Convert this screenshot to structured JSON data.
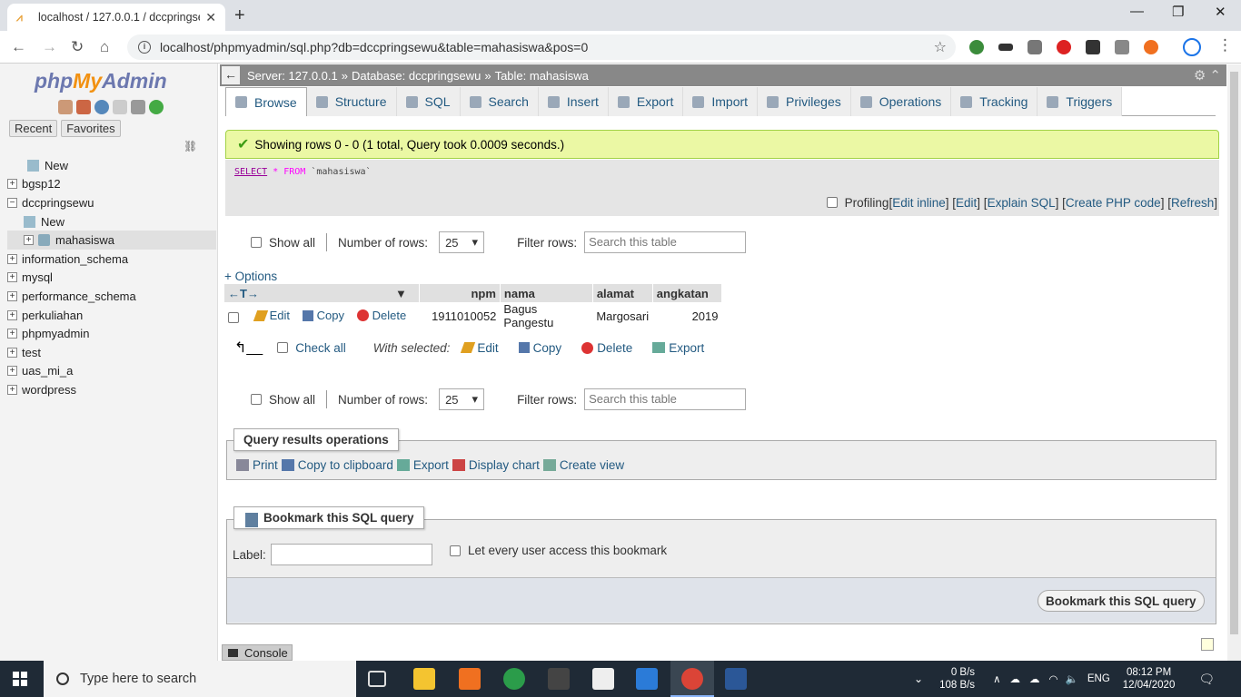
{
  "browser": {
    "tab_title": "localhost / 127.0.0.1 / dccpringse",
    "url": "localhost/phpmyadmin/sql.php?db=dccpringsewu&table=mahasiswa&pos=0"
  },
  "logo": {
    "php": "php",
    "my": "My",
    "admin": "Admin"
  },
  "left": {
    "recent": "Recent",
    "favorites": "Favorites",
    "tree": [
      {
        "label": "New",
        "type": "new",
        "indent": 1
      },
      {
        "label": "bgsp12",
        "type": "db",
        "indent": 0
      },
      {
        "label": "dccpringsewu",
        "type": "db-open",
        "indent": 0
      },
      {
        "label": "New",
        "type": "new",
        "indent": 2
      },
      {
        "label": "mahasiswa",
        "type": "table",
        "indent": 2
      },
      {
        "label": "information_schema",
        "type": "db",
        "indent": 0
      },
      {
        "label": "mysql",
        "type": "db",
        "indent": 0
      },
      {
        "label": "performance_schema",
        "type": "db",
        "indent": 0
      },
      {
        "label": "perkuliahan",
        "type": "db",
        "indent": 0
      },
      {
        "label": "phpmyadmin",
        "type": "db",
        "indent": 0
      },
      {
        "label": "test",
        "type": "db",
        "indent": 0
      },
      {
        "label": "uas_mi_a",
        "type": "db",
        "indent": 0
      },
      {
        "label": "wordpress",
        "type": "db",
        "indent": 0
      }
    ]
  },
  "breadcrumb": {
    "server": "Server: 127.0.0.1",
    "database": "Database: dccpringsewu",
    "table": "Table: mahasiswa",
    "sep": "»"
  },
  "tabs": [
    "Browse",
    "Structure",
    "SQL",
    "Search",
    "Insert",
    "Export",
    "Import",
    "Privileges",
    "Operations",
    "Tracking",
    "Triggers"
  ],
  "message": "Showing rows 0 - 0 (1 total, Query took 0.0009 seconds.)",
  "sql": {
    "select": "SELECT",
    "star": "*",
    "from": "FROM",
    "table": "`mahasiswa`"
  },
  "profiling": {
    "label": "Profiling",
    "links": [
      "Edit inline",
      "Edit",
      "Explain SQL",
      "Create PHP code",
      "Refresh"
    ]
  },
  "nav": {
    "show_all": "Show all",
    "rows_label": "Number of rows:",
    "rows_value": "25",
    "filter_label": "Filter rows:",
    "filter_placeholder": "Search this table"
  },
  "options": "+ Options",
  "columns": [
    "npm",
    "nama",
    "alamat",
    "angkatan"
  ],
  "rows": [
    {
      "npm": "1911010052",
      "nama": "Bagus Pangestu",
      "alamat": "Margosari",
      "angkatan": "2019"
    }
  ],
  "row_actions": {
    "edit": "Edit",
    "copy": "Copy",
    "delete": "Delete",
    "export": "Export"
  },
  "with_selected": {
    "check_all": "Check all",
    "label": "With selected:"
  },
  "qro": {
    "legend": "Query results operations",
    "links": [
      "Print",
      "Copy to clipboard",
      "Export",
      "Display chart",
      "Create view"
    ]
  },
  "bookmark": {
    "legend": "Bookmark this SQL query",
    "label": "Label:",
    "every_user": "Let every user access this bookmark",
    "button": "Bookmark this SQL query"
  },
  "console": "Console",
  "taskbar": {
    "search": "Type here to search",
    "net_up": "0 B/s",
    "net_down": "108 B/s",
    "lang": "ENG",
    "time": "08:12 PM",
    "date": "12/04/2020"
  }
}
